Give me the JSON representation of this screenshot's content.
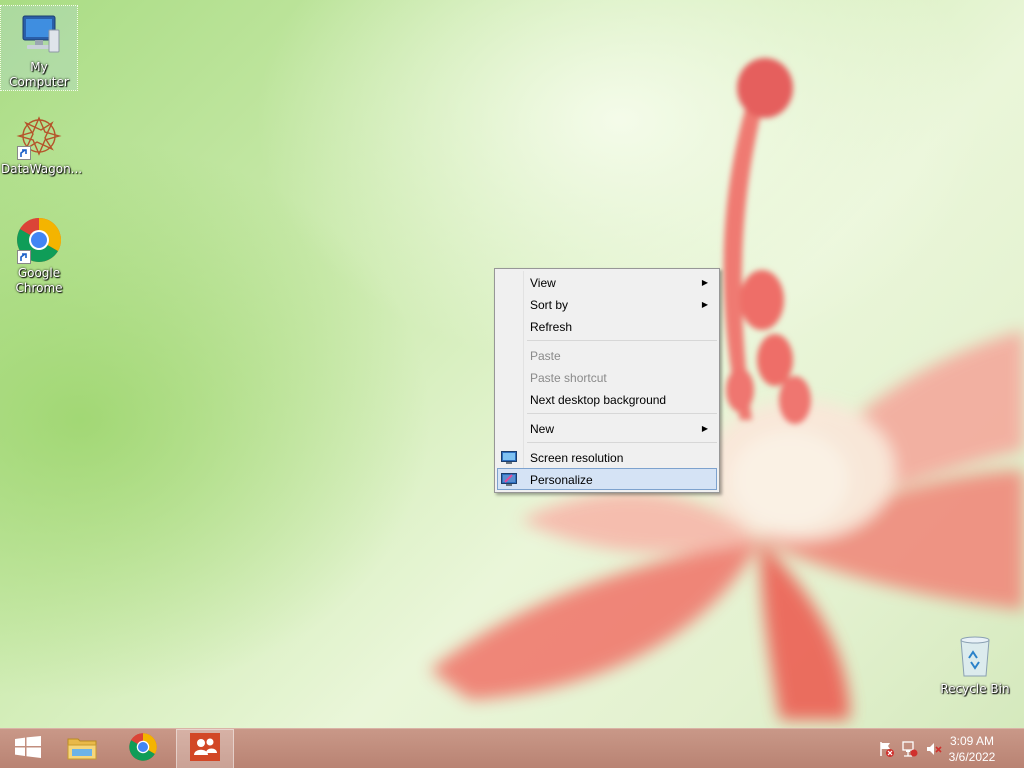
{
  "desktop": {
    "icons": [
      {
        "label": "My Computer",
        "icon": "computer-icon"
      },
      {
        "label": "DataWagon...",
        "icon": "datawagon-icon"
      },
      {
        "label": "Google Chrome",
        "icon": "chrome-icon"
      },
      {
        "label": "Recycle Bin",
        "icon": "recycle-bin-icon"
      }
    ]
  },
  "context_menu": {
    "groups": [
      [
        {
          "label": "View",
          "submenu": true,
          "enabled": true
        },
        {
          "label": "Sort by",
          "submenu": true,
          "enabled": true
        },
        {
          "label": "Refresh",
          "submenu": false,
          "enabled": true
        }
      ],
      [
        {
          "label": "Paste",
          "submenu": false,
          "enabled": false
        },
        {
          "label": "Paste shortcut",
          "submenu": false,
          "enabled": false
        },
        {
          "label": "Next desktop background",
          "submenu": false,
          "enabled": true
        }
      ],
      [
        {
          "label": "New",
          "submenu": true,
          "enabled": true
        }
      ],
      [
        {
          "label": "Screen resolution",
          "submenu": false,
          "enabled": true,
          "icon": "display-icon"
        },
        {
          "label": "Personalize",
          "submenu": false,
          "enabled": true,
          "icon": "personalize-icon",
          "highlighted": true
        }
      ]
    ],
    "arrow_glyph": "▶"
  },
  "taskbar": {
    "buttons": [
      {
        "icon": "windows-start-icon"
      },
      {
        "icon": "file-explorer-icon"
      },
      {
        "icon": "chrome-icon"
      },
      {
        "icon": "people-app-icon",
        "active": true
      }
    ],
    "tray": {
      "icons": [
        "action-center-flag-icon",
        "network-icon",
        "volume-muted-icon"
      ],
      "time": "3:09 AM",
      "date": "3/6/2022"
    }
  },
  "colors": {
    "taskbar": "#c28d7d",
    "menu_highlight": "#d5e3f5",
    "menu_highlight_border": "#7da2ce"
  }
}
